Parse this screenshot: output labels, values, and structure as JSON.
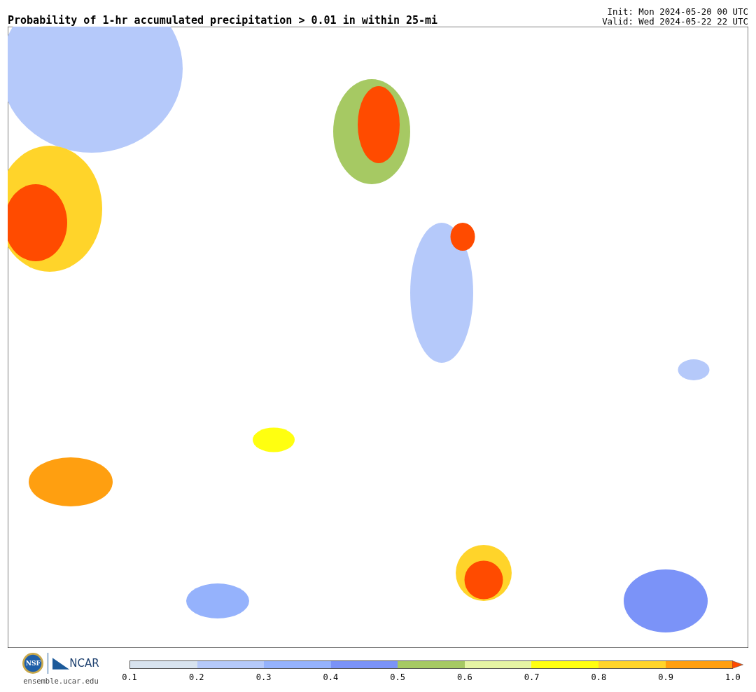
{
  "header": {
    "title": "Probability of 1-hr accumulated precipitation > 0.01 in within 25-mi",
    "init": "Init: Mon 2024-05-20 00 UTC",
    "valid": "Valid: Wed 2024-05-22 22 UTC"
  },
  "footer": {
    "nsf_logo": "NSF",
    "ncar_logo": "NCAR",
    "site": "ensemble.ucar.edu"
  },
  "colorbar": {
    "bins": [
      {
        "color": "#d8e3ef"
      },
      {
        "color": "#b5c9fa"
      },
      {
        "color": "#95b2fc"
      },
      {
        "color": "#7b93f8"
      },
      {
        "color": "#a6c963"
      },
      {
        "color": "#e6f5a4"
      },
      {
        "color": "#ffff10"
      },
      {
        "color": "#ffd42a"
      },
      {
        "color": "#ff9f10"
      }
    ],
    "over": {
      "color": "#ff4b00"
    },
    "ticks": [
      "0.1",
      "0.2",
      "0.3",
      "0.4",
      "0.5",
      "0.6",
      "0.7",
      "0.8",
      "0.9",
      "1.0"
    ]
  }
}
